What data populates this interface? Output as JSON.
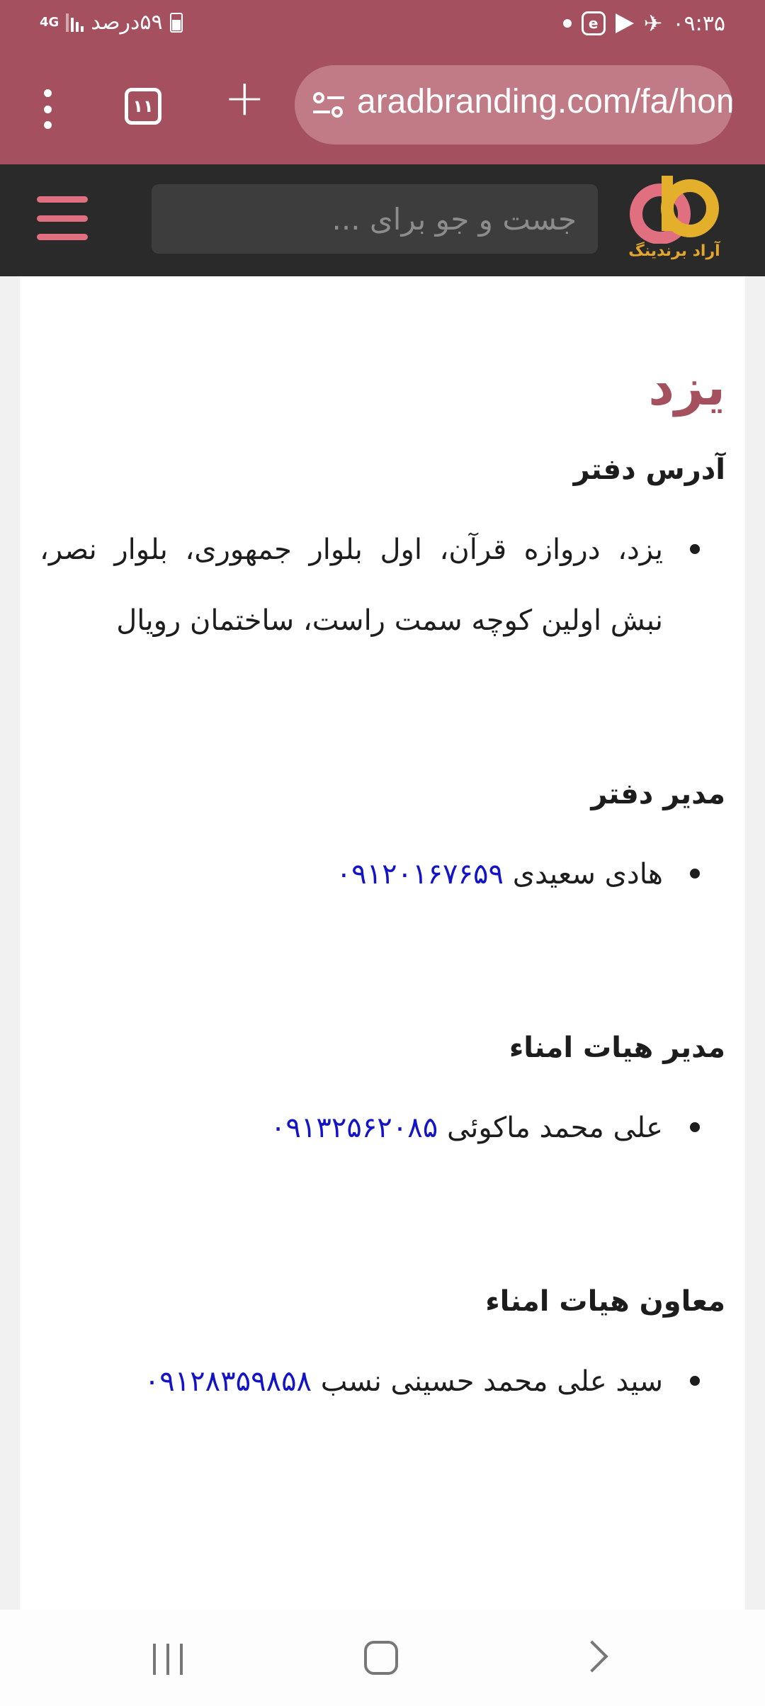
{
  "status_bar": {
    "time": "۰۹:۳۵",
    "battery": "۵۹درصد",
    "network": "4G"
  },
  "browser": {
    "url": "aradbranding.com/fa/home",
    "tab_count": "۱۱"
  },
  "site_header": {
    "search_placeholder": "جست و جو برای ...",
    "logo_text": "آراد برندینگ"
  },
  "content": {
    "city": "یزد",
    "sections": [
      {
        "heading": "آدرس دفتر",
        "text": "یزد، دروازه قرآن، اول بلوار جمهوری، بلوار نصر، نبش اولین کوچه سمت راست، ساختمان رویال"
      },
      {
        "heading": "مدیر دفتر",
        "name": "هادی سعیدی",
        "phone": "۰۹۱۲۰۱۶۷۶۵۹"
      },
      {
        "heading": "مدیر هیات امناء",
        "name": "علی محمد ماکوئی",
        "phone": "۰۹۱۳۲۵۶۲۰۸۵"
      },
      {
        "heading": "معاون هیات امناء",
        "name": "سید علی محمد حسینی نسب",
        "phone": "۰۹۱۲۸۳۵۹۸۵۸"
      }
    ]
  },
  "colors": {
    "brand": "#a5505e",
    "header_bg": "#2a2a2a",
    "link": "#1313c7"
  }
}
